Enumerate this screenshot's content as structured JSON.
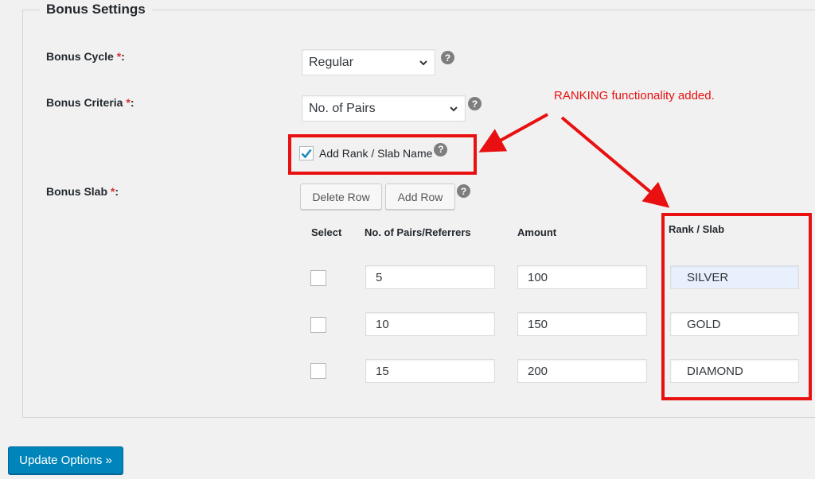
{
  "section": {
    "legend": "Bonus Settings"
  },
  "fields": {
    "bonus_cycle": {
      "label": "Bonus Cycle",
      "required_mark": "*",
      "colon": ":",
      "value": "Regular"
    },
    "bonus_criteria": {
      "label": "Bonus Criteria",
      "required_mark": "*",
      "colon": ":",
      "value": "No. of Pairs"
    },
    "add_rank": {
      "label": "Add Rank / Slab Name",
      "checked": true
    },
    "bonus_slab": {
      "label": "Bonus Slab",
      "required_mark": "*",
      "colon": ":"
    }
  },
  "help_icon_glyph": "?",
  "buttons": {
    "delete_row": "Delete Row",
    "add_row": "Add Row",
    "update": "Update Options »"
  },
  "table": {
    "headers": {
      "select": "Select",
      "pairs": "No. of Pairs/Referrers",
      "amount": "Amount",
      "rank": "Rank / Slab"
    },
    "rows": [
      {
        "pairs": "5",
        "amount": "100",
        "rank": "SILVER"
      },
      {
        "pairs": "10",
        "amount": "150",
        "rank": "GOLD"
      },
      {
        "pairs": "15",
        "amount": "200",
        "rank": "DIAMOND"
      }
    ]
  },
  "annotation": {
    "text": "RANKING functionality added.",
    "color": "#e81010"
  },
  "colors": {
    "primary_button": "#0085ba",
    "required": "#dc3232",
    "checkmark": "#1e8cbe"
  }
}
